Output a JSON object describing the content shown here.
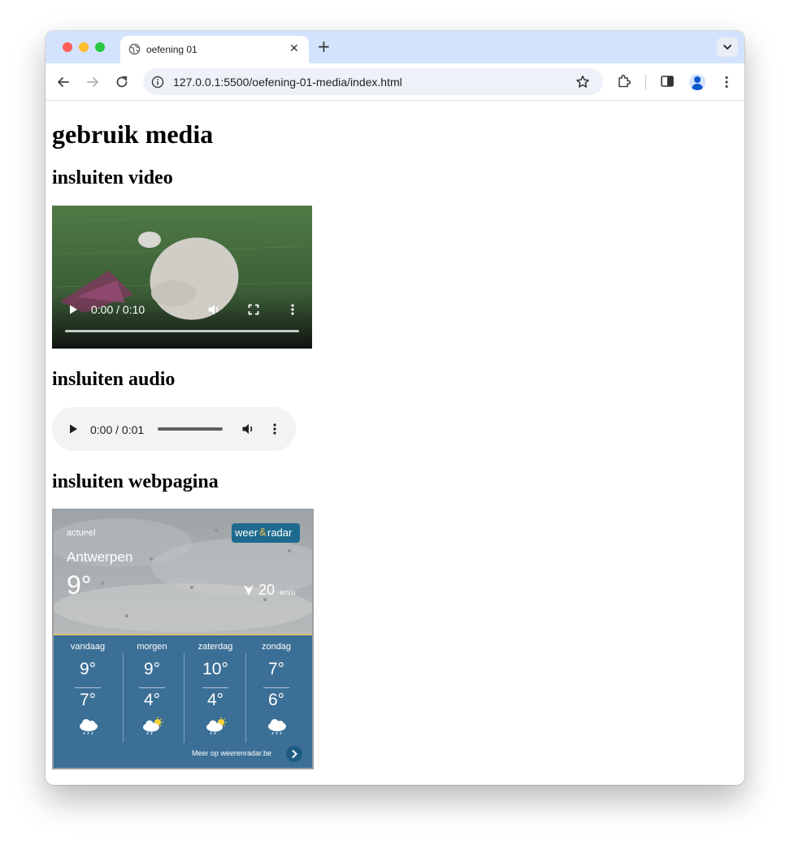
{
  "browser": {
    "tab_title": "oefening 01",
    "url": "127.0.0.1:5500/oefening-01-media/index.html"
  },
  "page": {
    "heading": "gebruik media",
    "video_heading": "insluiten video",
    "audio_heading": "insluiten audio",
    "webpage_heading": "insluiten webpagina"
  },
  "video": {
    "time": "0:00 / 0:10",
    "progress": 0
  },
  "audio": {
    "time": "0:00 / 0:01",
    "progress": 0
  },
  "weather": {
    "label": "actueel",
    "brand_a": "weer",
    "brand_b": "radar",
    "city": "Antwerpen",
    "current_temp": "9°",
    "wind_speed": "20",
    "wind_unit": "km/u",
    "days": [
      {
        "name": "vandaag",
        "max": "9°",
        "min": "7°",
        "icon": "cloud-rain-icon"
      },
      {
        "name": "morgen",
        "max": "9°",
        "min": "4°",
        "icon": "sun-cloud-rain-icon"
      },
      {
        "name": "zaterdag",
        "max": "10°",
        "min": "4°",
        "icon": "sun-cloud-rain-icon"
      },
      {
        "name": "zondag",
        "max": "7°",
        "min": "6°",
        "icon": "cloud-rain-icon"
      }
    ],
    "more_link": "Meer op weerenradar.be"
  },
  "colors": {
    "tab_strip": "#d3e3fd",
    "weather_panel": "#3b6f96",
    "weather_badge": "#1e6a8f",
    "weather_accent": "#e2c26a"
  }
}
